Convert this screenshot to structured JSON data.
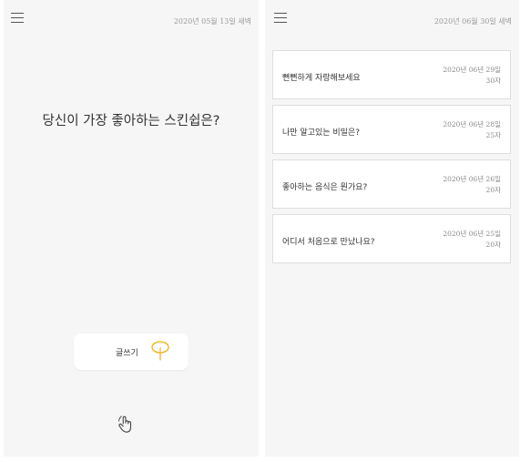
{
  "left_screen": {
    "menu_icon": "hamburger-menu-icon",
    "date": "2020년 05월 13일 새벽",
    "question": "당신이 가장 좋아하는 스킨쉽은?",
    "write_button": {
      "label": "글쓰기",
      "icon": "ginkgo-leaf-icon"
    },
    "bottom_icon": "hand-tap-icon"
  },
  "right_screen": {
    "menu_icon": "hamburger-menu-icon",
    "date": "2020년 06월 30일 새벽",
    "posts": [
      {
        "title": "뻔뻔하게 자랑해보세요",
        "date": "2020년 06년 29일",
        "count": "30자"
      },
      {
        "title": "나만 알고있는 비밀은?",
        "date": "2020년 06년 28일",
        "count": "25자"
      },
      {
        "title": "좋아하는 음식은 뭔가요?",
        "date": "2020년 06년 26일",
        "count": "20자"
      },
      {
        "title": "어디서 처음으로 만났나요?",
        "date": "2020년 06년 25일",
        "count": "20자"
      }
    ]
  },
  "colors": {
    "background": "#f6f6f6",
    "card": "#ffffff",
    "accent": "#f2b01e",
    "text": "#333333",
    "muted": "#9a9a9a"
  }
}
